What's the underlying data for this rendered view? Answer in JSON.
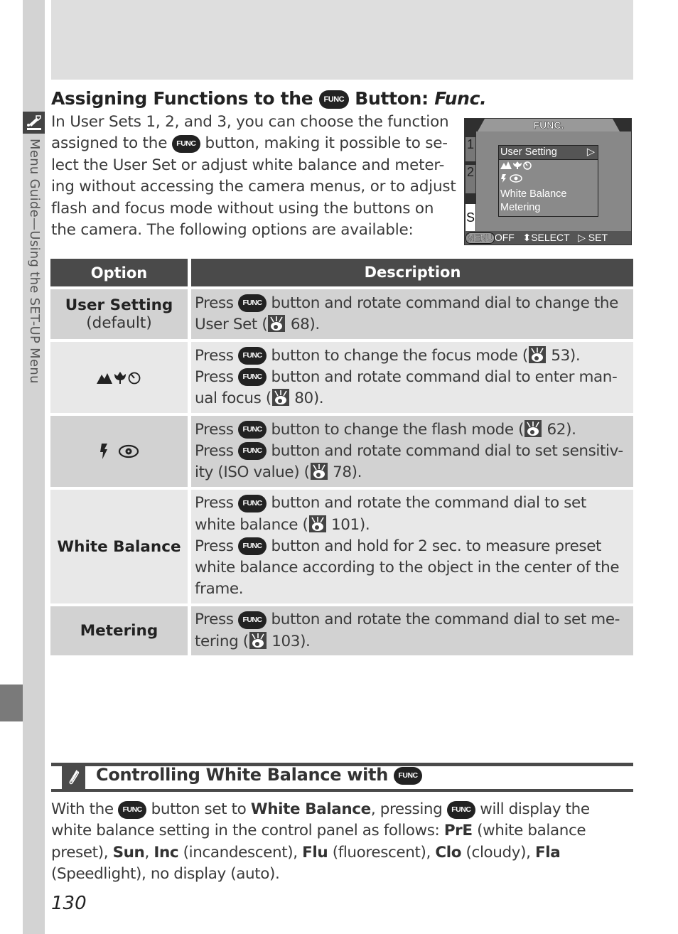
{
  "side_tab": {
    "label": "Menu Guide—Using the SET-UP Menu",
    "icon": "wrench-screwdriver-icon"
  },
  "heading": {
    "prefix": "Assigning Functions to the",
    "func_badge": "FUNC",
    "suffix": "Button:",
    "italic": "Func."
  },
  "intro": {
    "part1": "In User Sets 1, 2, and 3, you can choose the function assigned to the",
    "func_badge": "FUNC",
    "part2": "button, making it possible to se-lect the User Set or adjust white balance and meter-ing without accessing the camera menus, or to adjust flash and focus mode without using the buttons on the camera. The following options are available:"
  },
  "camera_screen": {
    "title": "FUNC.",
    "tabs": [
      "1",
      "2",
      "S"
    ],
    "menu_items": [
      {
        "label": "User Setting",
        "selected": true,
        "arrow": "▷"
      },
      {
        "label": "focus-mode-icons",
        "icons": "▲✿⏲"
      },
      {
        "label": "flash-iso-icons",
        "icons": "ϟ◉"
      },
      {
        "label": "White Balance"
      },
      {
        "label": "Metering"
      }
    ],
    "footer": {
      "menu_key": "MENU",
      "off": "OFF",
      "select_arrow": "⬍",
      "select": "SELECT",
      "set_arrow": "▷",
      "set": "SET"
    }
  },
  "table": {
    "headers": {
      "option": "Option",
      "description": "Description"
    },
    "rows": [
      {
        "option": "User Setting",
        "option_sub": "(default)",
        "lines": [
          {
            "pre": "Press",
            "func": "FUNC",
            "post": "button and rotate command dial to change the User Set (",
            "ref": "68",
            "end": ")."
          }
        ]
      },
      {
        "option_icons": "focus-mode / macro / self-timer",
        "lines": [
          {
            "pre": "Press",
            "func": "FUNC",
            "post": "button to change the focus mode (",
            "ref": "53",
            "end": ")."
          },
          {
            "pre": "Press",
            "func": "FUNC",
            "post": "button and rotate command dial to enter man-ual focus (",
            "ref": "80",
            "end": ")."
          }
        ]
      },
      {
        "option_icons": "flash / sensitivity",
        "lines": [
          {
            "pre": "Press",
            "func": "FUNC",
            "post": "button to change the flash mode (",
            "ref": "62",
            "end": ")."
          },
          {
            "pre": "Press",
            "func": "FUNC",
            "post": "button and rotate command dial to set sensitiv-ity (ISO value) (",
            "ref": "78",
            "end": ")."
          }
        ]
      },
      {
        "option": "White Balance",
        "lines": [
          {
            "pre": "Press",
            "func": "FUNC",
            "post": "button and rotate the command dial to set white balance (",
            "ref": "101",
            "end": ")."
          },
          {
            "pre": "Press",
            "func": "FUNC",
            "post": "button and hold for 2 sec. to measure preset white balance according to the object in the center of the frame.",
            "ref": null,
            "end": ""
          }
        ]
      },
      {
        "option": "Metering",
        "lines": [
          {
            "pre": "Press",
            "func": "FUNC",
            "post": "button and rotate the command dial to set me-tering (",
            "ref": "103",
            "end": ")."
          }
        ]
      }
    ]
  },
  "note": {
    "icon": "paperclip-icon",
    "title": "Controlling White Balance with",
    "title_func": "FUNC",
    "body": {
      "t1": "With the",
      "func1": "FUNC",
      "t2": "button set to",
      "b1": "White Balance",
      "t3": ", pressing",
      "func2": "FUNC",
      "t4": " will display the white balance setting in the control panel as follows:",
      "b_pre": "PrE",
      "t_pre": "(white balance preset),",
      "b_sun": "Sun",
      "t_sun": ",",
      "b_inc": "Inc",
      "t_inc": "(incandescent),",
      "b_flu": "Flu",
      "t_flu": "(fluorescent),",
      "b_clo": "Clo",
      "t_clo": "(cloudy),",
      "b_fla": "Fla",
      "t_fla": "(Speedlight), no display (auto)."
    }
  },
  "page_number": "130"
}
